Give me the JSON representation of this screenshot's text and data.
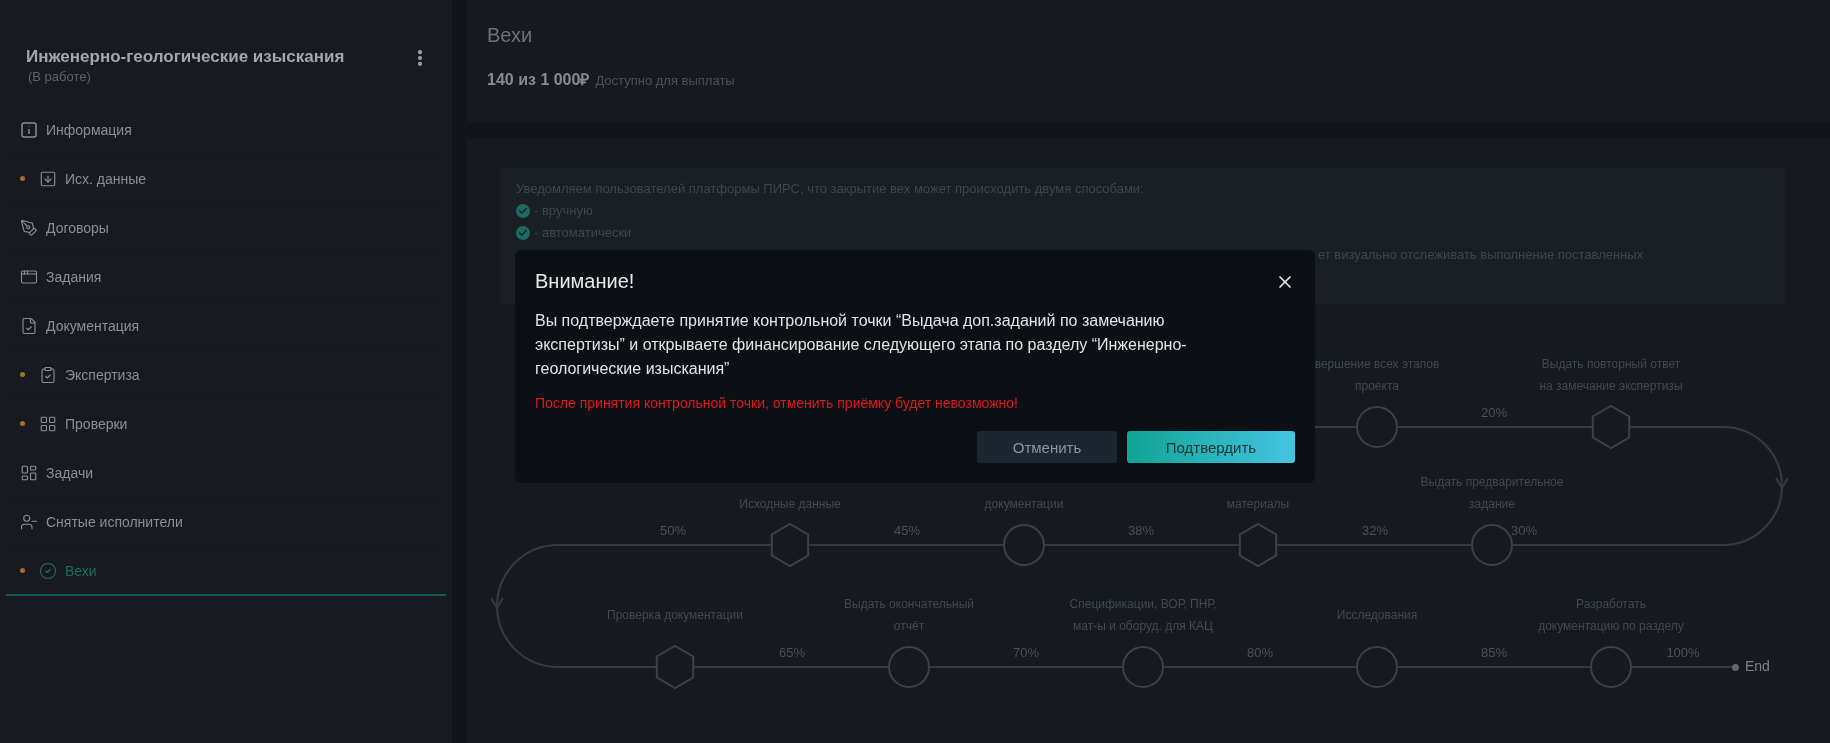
{
  "sidebar": {
    "title": "Инженерно-геологические изыскания",
    "status": "(В работе)",
    "items": [
      {
        "label": "Информация",
        "dot": false,
        "selected": false
      },
      {
        "label": "Исх. данные",
        "dot": true,
        "selected": false
      },
      {
        "label": "Договоры",
        "dot": false,
        "selected": false
      },
      {
        "label": "Задания",
        "dot": false,
        "selected": false
      },
      {
        "label": "Документация",
        "dot": false,
        "selected": false
      },
      {
        "label": "Экспертиза",
        "dot": true,
        "selected": false
      },
      {
        "label": "Проверки",
        "dot": true,
        "selected": false
      },
      {
        "label": "Задачи",
        "dot": false,
        "selected": false
      },
      {
        "label": "Снятые исполнители",
        "dot": false,
        "selected": false
      },
      {
        "label": "Вехи",
        "dot": true,
        "selected": true
      }
    ]
  },
  "header": {
    "title": "Вехи",
    "amount": "140 из 1 000₽",
    "amount_caption": "Доступно для выплаты"
  },
  "notice": {
    "lines": [
      {
        "kind": "text",
        "text": "Уведомляем пользователей платформы ПИРС, что закрытие вех может происходить двумя способами:"
      },
      {
        "kind": "check",
        "text": "- вручную"
      },
      {
        "kind": "check",
        "text": "- автоматически"
      },
      {
        "kind": "fragment",
        "text": "ет визуально отслеживать выполнение поставленных"
      }
    ]
  },
  "timeline": {
    "rows": [
      {
        "items": [
          {
            "kind": "circle",
            "label": "вершение всех этапов\nпроекта"
          },
          {
            "kind": "percent",
            "text": "20%"
          },
          {
            "kind": "hexagon",
            "label": "Выдать повторный ответ\nна замечание экспертизы"
          }
        ]
      },
      {
        "items": [
          {
            "kind": "percent",
            "text": "50%"
          },
          {
            "kind": "hexagon",
            "label": "Исходные данные"
          },
          {
            "kind": "percent",
            "text": "45%"
          },
          {
            "kind": "circle",
            "label": "документации"
          },
          {
            "kind": "percent",
            "text": "38%"
          },
          {
            "kind": "hexagon",
            "label": "материалы"
          },
          {
            "kind": "percent",
            "text": "32%"
          },
          {
            "kind": "circle",
            "label": "Выдать предварительное\nзадание"
          },
          {
            "kind": "percent",
            "text": "30%"
          }
        ]
      },
      {
        "items": [
          {
            "kind": "hexagon",
            "label": "Проверка документации"
          },
          {
            "kind": "percent",
            "text": "65%"
          },
          {
            "kind": "circle",
            "label": "Выдать окончательный\nотчёт"
          },
          {
            "kind": "percent",
            "text": "70%"
          },
          {
            "kind": "circle",
            "label": "Спецификации, ВОР, ПНР,\nмат-ы и оборуд. для КАЦ"
          },
          {
            "kind": "percent",
            "text": "80%"
          },
          {
            "kind": "circle",
            "label": "Исследования"
          },
          {
            "kind": "percent",
            "text": "85%"
          },
          {
            "kind": "circle",
            "label": "Разработать\nдокументацию по разделу"
          },
          {
            "kind": "percent",
            "text": "100%"
          }
        ]
      }
    ],
    "end_label": "End"
  },
  "dialog": {
    "title": "Внимание!",
    "message": "Вы подтверждаете принятие контрольной точки “Выдача доп.заданий по замечанию экспертизы” и открываете финансирование следующего этапа по разделу “Инженерно-геологические изыскания”",
    "warning": "После принятия контрольной точки, отменить приёмку будет невозможно!",
    "buttons": [
      {
        "label": "Отменить",
        "kind": "secondary"
      },
      {
        "label": "Подтвердить",
        "kind": "primary"
      }
    ]
  }
}
